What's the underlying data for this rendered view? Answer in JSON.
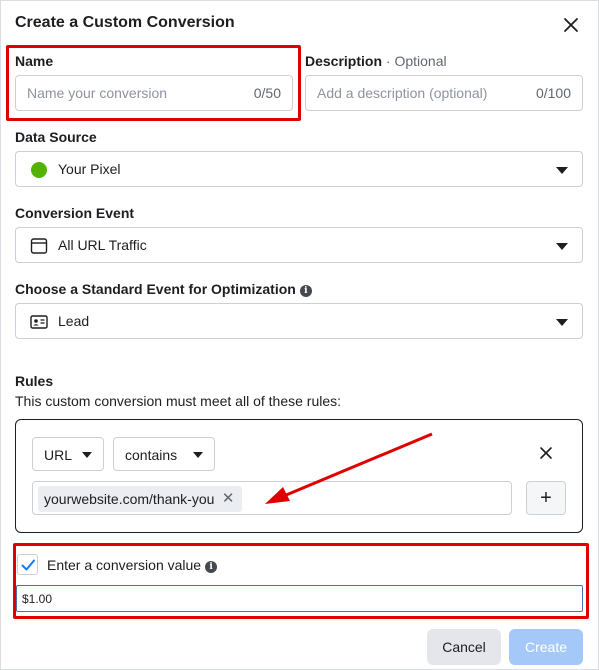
{
  "dialog": {
    "title": "Create a Custom Conversion"
  },
  "name": {
    "label": "Name",
    "placeholder": "Name your conversion",
    "count": "0/50"
  },
  "description": {
    "label": "Description",
    "optional": "· Optional",
    "placeholder": "Add a description (optional)",
    "count": "0/100"
  },
  "data_source": {
    "label": "Data Source",
    "value": "Your Pixel",
    "status_color": "#52b400"
  },
  "conversion_event": {
    "label": "Conversion Event",
    "value": "All URL Traffic",
    "icon": "browser-window-icon"
  },
  "standard_event": {
    "label": "Choose a Standard Event for Optimization",
    "value": "Lead",
    "icon": "contact-card-icon"
  },
  "rules": {
    "label": "Rules",
    "description": "This custom conversion must meet all of these rules:",
    "field": "URL",
    "operator": "contains",
    "chip": "yourwebsite.com/thank-you",
    "chip_remove": "✕",
    "add": "+"
  },
  "conversion_value": {
    "label": "Enter a conversion value",
    "checked": true,
    "value": "$1.00",
    "check_color": "#1877f2"
  },
  "footer": {
    "cancel": "Cancel",
    "create": "Create"
  },
  "annotation": {
    "color": "#e00000"
  }
}
